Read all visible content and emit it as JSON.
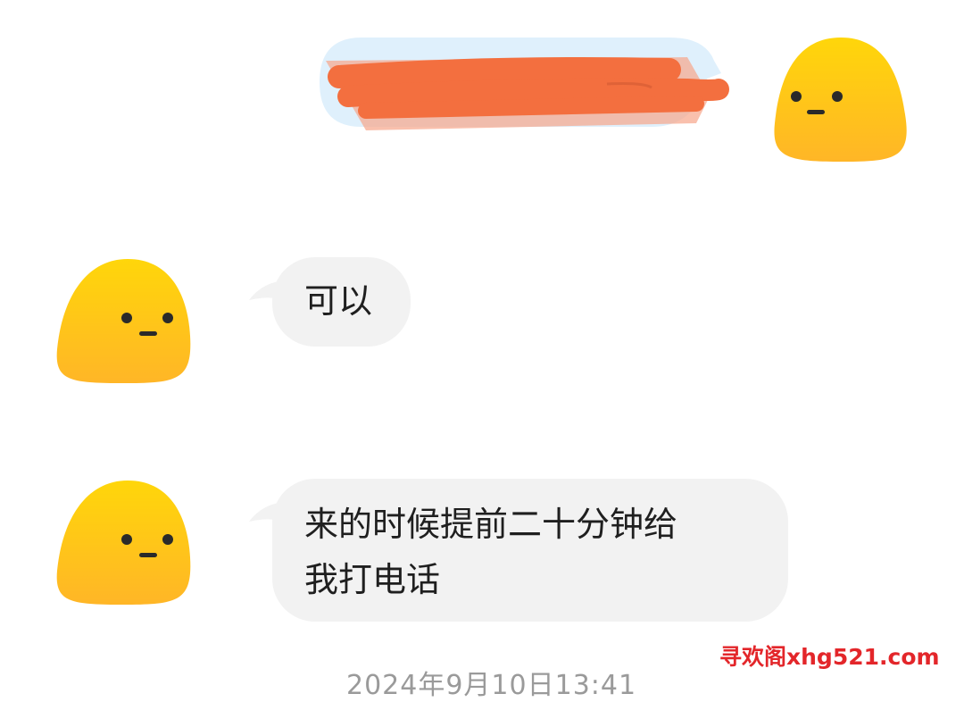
{
  "messages": [
    {
      "side": "received",
      "text": "可以"
    },
    {
      "side": "received",
      "lines": [
        "来的时候提前二十分钟给",
        "我打电话"
      ]
    }
  ],
  "sent_message": {
    "redacted": true,
    "redaction_color": "#f36f3f",
    "bubble_color": "#dff0fc"
  },
  "avatar": {
    "icon": "yellow-blob-face-icon",
    "color_top": "#ffd60a",
    "color_bottom": "#ffb627"
  },
  "timestamp": "2024年9月10日13:41",
  "watermark": "寻欢阁xhg521.com"
}
